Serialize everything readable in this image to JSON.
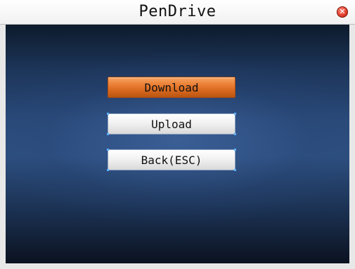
{
  "window": {
    "title": "PenDrive",
    "close_icon": "close-icon",
    "accent_color": "#e6762b",
    "close_color": "#e23b2a"
  },
  "menu": {
    "selected_index": 0,
    "items": [
      {
        "label": "Download"
      },
      {
        "label": "Upload"
      },
      {
        "label": "Back(ESC)"
      }
    ]
  }
}
